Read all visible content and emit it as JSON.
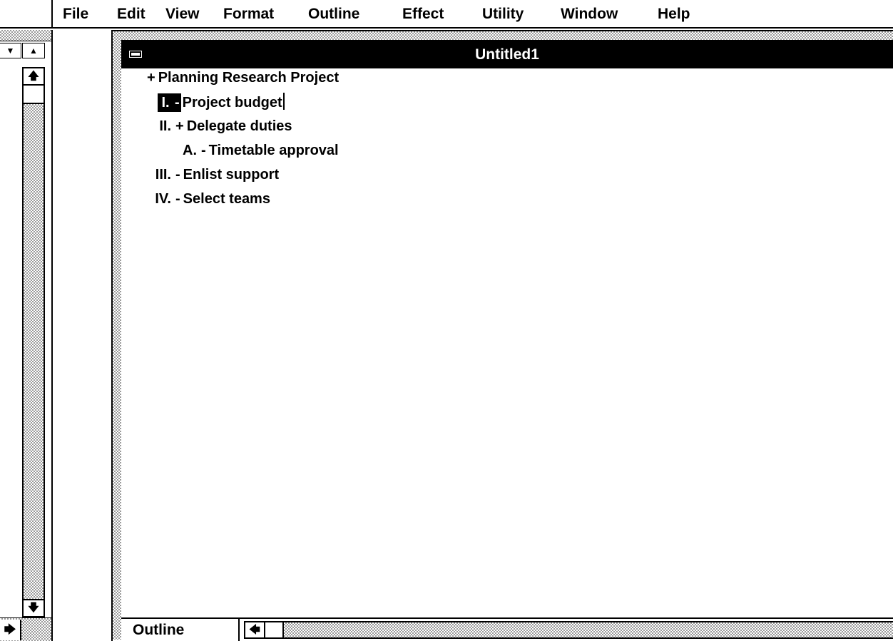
{
  "menu": {
    "items": [
      {
        "label": "File"
      },
      {
        "label": "Edit"
      },
      {
        "label": "View"
      },
      {
        "label": "Format"
      },
      {
        "label": "Outline"
      },
      {
        "label": "Effect"
      },
      {
        "label": "Utility"
      },
      {
        "label": "Window"
      },
      {
        "label": "Help"
      }
    ]
  },
  "left_pane": {
    "icons": {
      "dropdown": "down-triangle-icon",
      "scroll_up_small": "up-triangle-icon",
      "scroll_up": "arrow-up-icon",
      "scroll_down": "arrow-down-icon",
      "scroll_right": "arrow-right-icon"
    },
    "glyphs": {
      "dropdown": "▼",
      "scroll_up_small": "▲",
      "scroll_up": "🡅",
      "scroll_down": "🡇",
      "scroll_right": "🡆"
    }
  },
  "window": {
    "title": "Untitled1",
    "system_menu_icon": "system-menu-icon"
  },
  "outline": {
    "items": [
      {
        "number": "",
        "marker": "+",
        "text": "Planning Research Project",
        "selected_number": false,
        "caret": false
      },
      {
        "number": "I.",
        "marker": "-",
        "text": "Project budget",
        "selected_number": true,
        "caret": true
      },
      {
        "number": "II.",
        "marker": "+",
        "text": "Delegate duties",
        "selected_number": false,
        "caret": false
      },
      {
        "number": "A.",
        "marker": "-",
        "text": "Timetable approval",
        "selected_number": false,
        "caret": false
      },
      {
        "number": "III.",
        "marker": "-",
        "text": "Enlist support",
        "selected_number": false,
        "caret": false
      },
      {
        "number": "IV.",
        "marker": "-",
        "text": "Select teams",
        "selected_number": false,
        "caret": false
      }
    ]
  },
  "status": {
    "view_label": "Outline",
    "scroll_left_glyph": "🡄",
    "scroll_left_icon": "arrow-left-icon"
  },
  "colors": {
    "title_bar": "#000000",
    "background": "#ffffff",
    "dither": "#9a9a9a"
  }
}
